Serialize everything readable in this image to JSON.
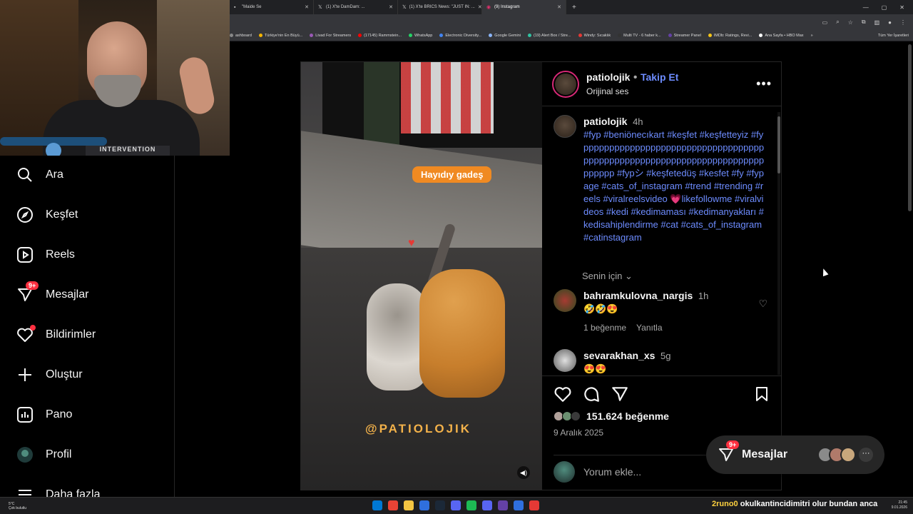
{
  "browser": {
    "tabs": [
      {
        "title": "\"Maide Se",
        "icon": "tab-icon",
        "active": false
      },
      {
        "title": "(1) X'te DamDam: ...",
        "icon": "x-icon",
        "active": false
      },
      {
        "title": "(1) X'te BRICS News: \"JUST IN: ...",
        "icon": "x-icon",
        "active": false
      },
      {
        "title": "(9) Instagram",
        "icon": "instagram-icon",
        "active": true
      }
    ],
    "bookmarks": [
      {
        "label": "ashboard",
        "color": "#888888"
      },
      {
        "label": "Türkiye'nin En Büyü...",
        "color": "#f4b400"
      },
      {
        "label": "Livad For Streamers",
        "color": "#9b59b6"
      },
      {
        "label": "(17145) Rammstein...",
        "color": "#ff0000"
      },
      {
        "label": "WhatsApp",
        "color": "#25d366"
      },
      {
        "label": "Electronic Diversity...",
        "color": "#4285f4"
      },
      {
        "label": "Google Gemini",
        "color": "#8ab4f8"
      },
      {
        "label": "(19) Alert Box / Stre...",
        "color": "#31c3a2"
      },
      {
        "label": "Windy: Sıcaklık",
        "color": "#e53935"
      },
      {
        "label": "Multi TV - 6 haber k...",
        "color": "#333333"
      },
      {
        "label": "Streamer Panel",
        "color": "#6441a5"
      },
      {
        "label": "IMDb: Ratings, Revi...",
        "color": "#f5c518"
      },
      {
        "label": "Ana Sayfa • HBO Max",
        "color": "#ffffff"
      }
    ],
    "bookmarks_more": "»",
    "bookmarks_all": "Tüm Yer İşaretleri"
  },
  "webcam": {
    "shirt_text": "INTERVENTION"
  },
  "nav": {
    "items": [
      {
        "label": "Ara",
        "icon": "search-icon"
      },
      {
        "label": "Keşfet",
        "icon": "compass-icon"
      },
      {
        "label": "Reels",
        "icon": "reels-icon"
      },
      {
        "label": "Mesajlar",
        "icon": "messenger-icon",
        "badge": "9+"
      },
      {
        "label": "Bildirimler",
        "icon": "heart-icon",
        "dot": true
      },
      {
        "label": "Oluştur",
        "icon": "plus-icon"
      },
      {
        "label": "Pano",
        "icon": "dashboard-icon"
      },
      {
        "label": "Profil",
        "icon": "profile-avatar"
      },
      {
        "label": "Daha fazla",
        "icon": "menu-icon"
      }
    ]
  },
  "post": {
    "username": "patiolojik",
    "follow_label": "Takip Et",
    "separator": "•",
    "audio": "Orijinal ses",
    "more_icon": "more-icon",
    "media": {
      "sticker": "Hayıdıy gadeş",
      "watermark": "@PATIOLOJIK",
      "mute_icon": "speaker-icon"
    },
    "caption": {
      "username": "patiolojik",
      "time": "4h",
      "hashtags": "#fyp #beniönecıkart #keşfet #keşfetteyiz #fypppppppppppppppppppppppppppppppppppppppppppppppppppppppppppppppppppppppppppp #fypシ #keşfetedüş #kesfet #fy #fypage #cats_of_instagram #trend #trending #reels #viralreelsvideo 💗likefollowme #viralvideos #kedi #kedimaması #kedimanyakları #kedisahiplendirme #cat #cats_of_instagram #catinstagram"
    },
    "for_you": "Senin için",
    "comments": [
      {
        "username": "bahramkulovna_nargis",
        "time": "1h",
        "text": "🤣🤣😍",
        "likes": "1 beğenme",
        "reply": "Yanıtla",
        "avatar_color": "#7a2f2a"
      },
      {
        "username": "sevarakhan_xs",
        "time": "5g",
        "text": "😍😍",
        "likes": "",
        "reply": "",
        "avatar_color": "#c7c7c7"
      }
    ],
    "likes_count": "151.624 beğenme",
    "date": "9 Aralık 2025",
    "add_comment_placeholder": "Yorum ekle..."
  },
  "messages_pill": {
    "label": "Mesajlar",
    "badge": "9+",
    "more": "···",
    "avatar_colors": [
      "#8a8a8a",
      "#b07a6a",
      "#c9a77c"
    ]
  },
  "taskbar": {
    "weather_temp": "5°C",
    "weather_desc": "Çok bulutlu",
    "ticker_user": "2runo0",
    "ticker_text": "okulkantincidimitri olur bundan anca",
    "time": "21:45",
    "date": "9.01.2026",
    "app_colors": [
      "#0078d4",
      "#ea4335",
      "#f4c542",
      "#2f6fde",
      "#1b2838",
      "#5865f2",
      "#1db954",
      "#5865f2",
      "#6441a5",
      "#2f6fde",
      "#e53935"
    ]
  }
}
